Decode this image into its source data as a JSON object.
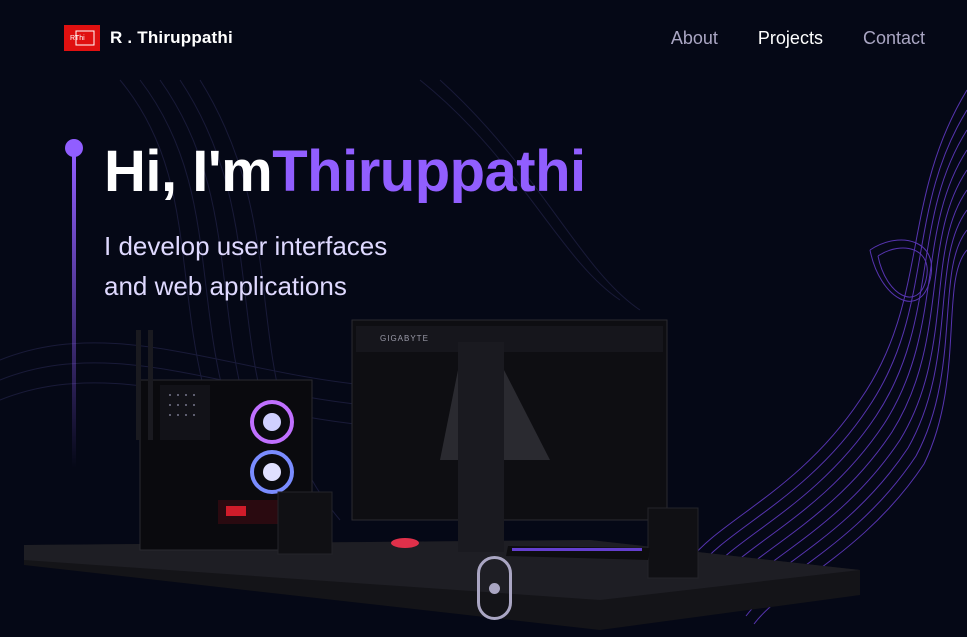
{
  "brand": {
    "logo_text": "RThi",
    "name": "R . Thiruppathi"
  },
  "nav": {
    "links": [
      {
        "label": "About",
        "active": false
      },
      {
        "label": "Projects",
        "active": true
      },
      {
        "label": "Contact",
        "active": false
      }
    ]
  },
  "hero": {
    "greeting": "Hi, I'm",
    "name": "Thiruppathi",
    "subtitle_line1": "I develop user interfaces",
    "subtitle_line2": "and web applications"
  },
  "scene": {
    "monitor_brand": "GIGABYTE"
  },
  "colors": {
    "background": "#050816",
    "accent": "#915eff",
    "nav_muted": "#aaa6c3",
    "logo_red": "#e01010"
  },
  "icons": {
    "logo": "logo-icon",
    "scroll": "scroll-mouse-icon"
  }
}
